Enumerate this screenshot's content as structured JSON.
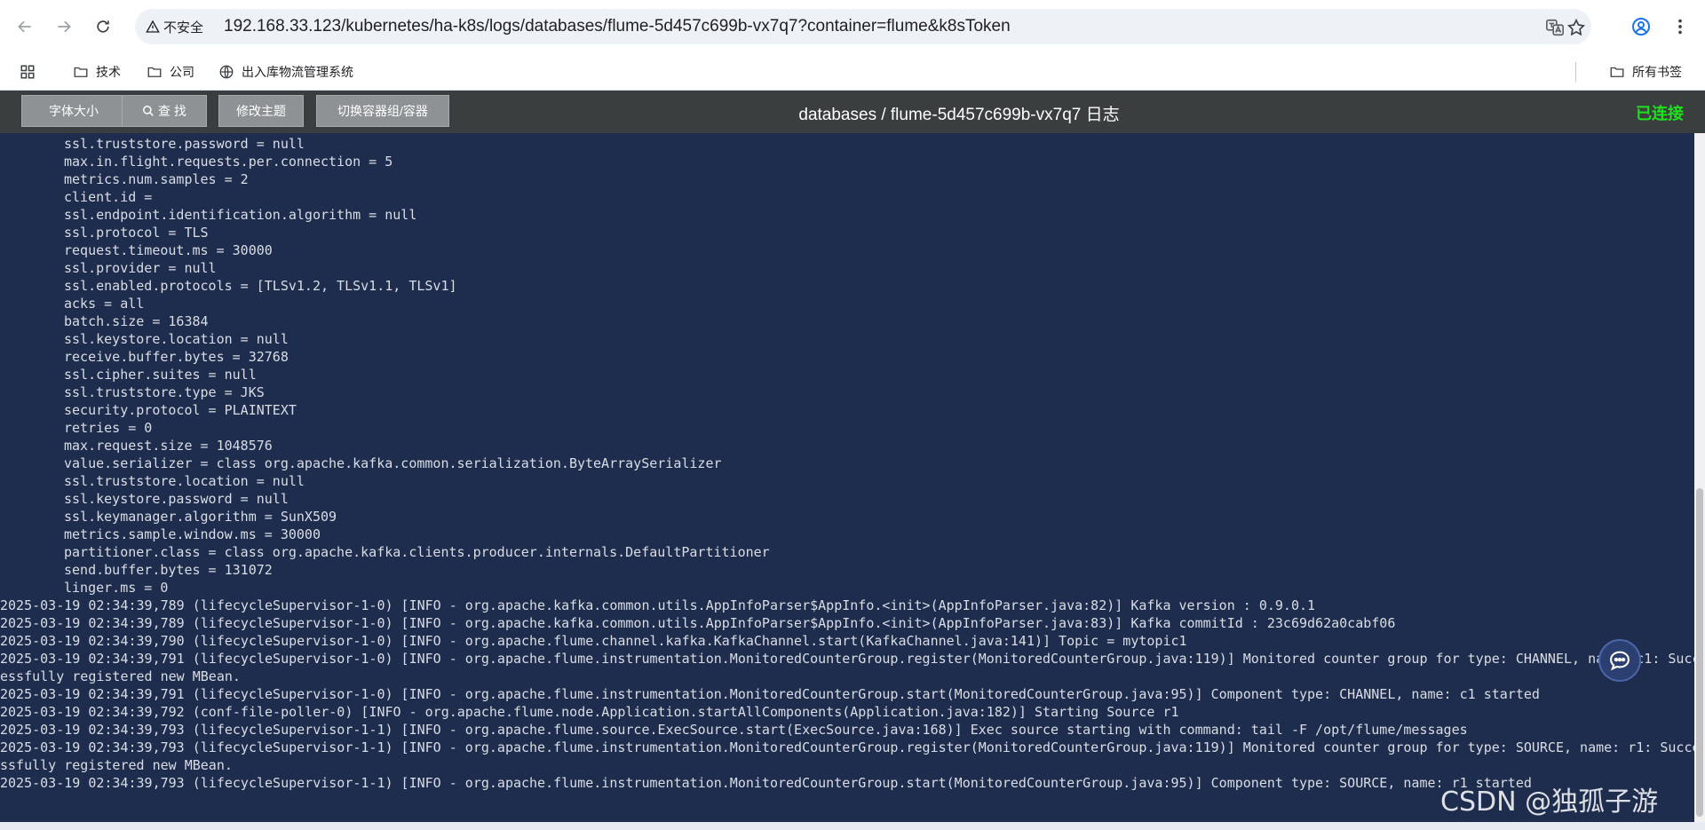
{
  "browser": {
    "security_label": "不安全",
    "url": "192.168.33.123/kubernetes/ha-k8s/logs/databases/flume-5d457c699b-vx7q7?container=flume&k8sToken"
  },
  "bookmarks": {
    "items": [
      "技术",
      "公司",
      "出入库物流管理系统"
    ],
    "all_bookmarks": "所有书签"
  },
  "toolbar": {
    "font_size_label": "字体大小",
    "search_label": "查 找",
    "theme_label": "修改主题",
    "switch_container_label": "切换容器组/容器",
    "title": "databases / flume-5d457c699b-vx7q7 日志",
    "status": "已连接"
  },
  "colors": {
    "log_background": "#1e2d4e",
    "toolbar_background": "#3b3e3f",
    "status_green": "#1ee11e"
  },
  "log": {
    "config_lines": [
      "ssl.truststore.password = null",
      "max.in.flight.requests.per.connection = 5",
      "metrics.num.samples = 2",
      "client.id =",
      "ssl.endpoint.identification.algorithm = null",
      "ssl.protocol = TLS",
      "request.timeout.ms = 30000",
      "ssl.provider = null",
      "ssl.enabled.protocols = [TLSv1.2, TLSv1.1, TLSv1]",
      "acks = all",
      "batch.size = 16384",
      "ssl.keystore.location = null",
      "receive.buffer.bytes = 32768",
      "ssl.cipher.suites = null",
      "ssl.truststore.type = JKS",
      "security.protocol = PLAINTEXT",
      "retries = 0",
      "max.request.size = 1048576",
      "value.serializer = class org.apache.kafka.common.serialization.ByteArraySerializer",
      "ssl.truststore.location = null",
      "ssl.keystore.password = null",
      "ssl.keymanager.algorithm = SunX509",
      "metrics.sample.window.ms = 30000",
      "partitioner.class = class org.apache.kafka.clients.producer.internals.DefaultPartitioner",
      "send.buffer.bytes = 131072",
      "linger.ms = 0"
    ],
    "event_lines": [
      "2025-03-19 02:34:39,789 (lifecycleSupervisor-1-0) [INFO - org.apache.kafka.common.utils.AppInfoParser$AppInfo.<init>(AppInfoParser.java:82)] Kafka version : 0.9.0.1",
      "2025-03-19 02:34:39,789 (lifecycleSupervisor-1-0) [INFO - org.apache.kafka.common.utils.AppInfoParser$AppInfo.<init>(AppInfoParser.java:83)] Kafka commitId : 23c69d62a0cabf06",
      "2025-03-19 02:34:39,790 (lifecycleSupervisor-1-0) [INFO - org.apache.flume.channel.kafka.KafkaChannel.start(KafkaChannel.java:141)] Topic = mytopic1",
      "2025-03-19 02:34:39,791 (lifecycleSupervisor-1-0) [INFO - org.apache.flume.instrumentation.MonitoredCounterGroup.register(MonitoredCounterGroup.java:119)] Monitored counter group for type: CHANNEL, name: c1: Succ",
      "essfully registered new MBean.",
      "2025-03-19 02:34:39,791 (lifecycleSupervisor-1-0) [INFO - org.apache.flume.instrumentation.MonitoredCounterGroup.start(MonitoredCounterGroup.java:95)] Component type: CHANNEL, name: c1 started",
      "2025-03-19 02:34:39,792 (conf-file-poller-0) [INFO - org.apache.flume.node.Application.startAllComponents(Application.java:182)] Starting Source r1",
      "2025-03-19 02:34:39,793 (lifecycleSupervisor-1-1) [INFO - org.apache.flume.source.ExecSource.start(ExecSource.java:168)] Exec source starting with command: tail -F /opt/flume/messages",
      "2025-03-19 02:34:39,793 (lifecycleSupervisor-1-1) [INFO - org.apache.flume.instrumentation.MonitoredCounterGroup.register(MonitoredCounterGroup.java:119)] Monitored counter group for type: SOURCE, name: r1: Succe",
      "ssfully registered new MBean.",
      "2025-03-19 02:34:39,793 (lifecycleSupervisor-1-1) [INFO - org.apache.flume.instrumentation.MonitoredCounterGroup.start(MonitoredCounterGroup.java:95)] Component type: SOURCE, name: r1 started"
    ]
  },
  "watermark": "CSDN @独孤子游"
}
